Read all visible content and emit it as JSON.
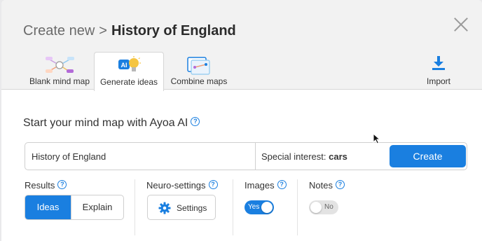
{
  "header": {
    "breadcrumb": "Create new",
    "separator": ">",
    "title": "History of England"
  },
  "tabs": [
    {
      "label": "Blank mind map",
      "icon": "blank-mind-map-icon",
      "active": false
    },
    {
      "label": "Generate ideas",
      "icon": "ai-lightbulb-icon",
      "active": true
    },
    {
      "label": "Combine maps",
      "icon": "combine-maps-icon",
      "active": false
    },
    {
      "label": "Import",
      "icon": "download-icon",
      "active": false
    }
  ],
  "main": {
    "section_title": "Start your mind map with Ayoa AI",
    "topic_value": "History of England",
    "special_interest_label": "Special interest:",
    "special_interest_value": "cars",
    "create_label": "Create"
  },
  "options": {
    "results": {
      "label": "Results",
      "options": [
        "Ideas",
        "Explain"
      ],
      "selected": "Ideas"
    },
    "neuro": {
      "label": "Neuro-settings",
      "button_label": "Settings"
    },
    "images": {
      "label": "Images",
      "toggle_text": "Yes",
      "on": true
    },
    "notes": {
      "label": "Notes",
      "toggle_text": "No",
      "on": false
    }
  },
  "icons": {
    "ai_badge": "AI",
    "help": "?"
  },
  "colors": {
    "accent": "#1a7fe0",
    "header_bg": "#f2f2f2"
  }
}
